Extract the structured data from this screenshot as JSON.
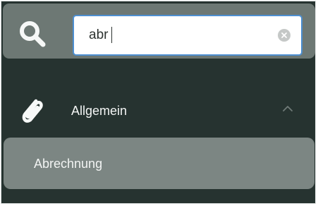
{
  "search": {
    "value": "abr",
    "icon": "search-icon",
    "clear_icon": "clear-icon",
    "accent_color": "#4d8fd1"
  },
  "category": {
    "label": "Allgemein",
    "icon": "paperclip-icon",
    "expanded": true,
    "toggle_icon": "chevron-up-icon"
  },
  "results": [
    {
      "label": "Abrechnung"
    }
  ],
  "colors": {
    "panel_background": "#263330",
    "search_band": "#6d7874",
    "selected_item": "#7c8683"
  }
}
